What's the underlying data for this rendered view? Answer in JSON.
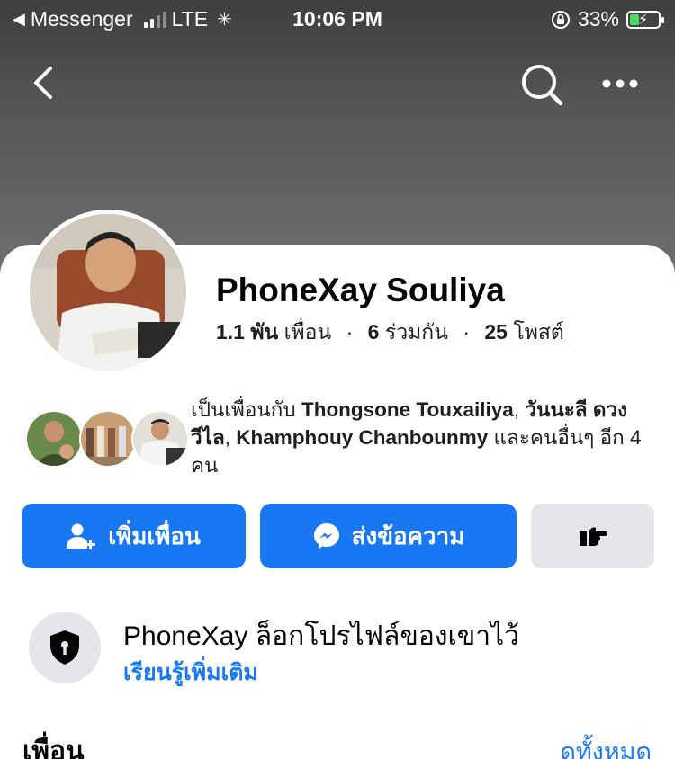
{
  "status_bar": {
    "back_app": "Messenger",
    "network": "LTE",
    "time": "10:06 PM",
    "battery": "33%"
  },
  "nav": {
    "back_icon": "chevron-left-icon",
    "search_icon": "search-icon",
    "more_icon": "more-horizontal-icon"
  },
  "profile": {
    "name": "PhoneXay Souliya",
    "friends_count": "1.1 พัน",
    "friends_label": "เพื่อน",
    "mutual_count": "6",
    "mutual_label": "ร่วมกัน",
    "posts_count": "25",
    "posts_label": "โพสต์"
  },
  "mutual": {
    "prefix": "เป็นเพื่อนกับ",
    "friend1": "Thongsone Touxailiya",
    "friend2": "วันนะลี ดวงวีไล",
    "friend3": "Khamphouy Chanbounmy",
    "suffix": "และคนอื่นๆ อีก 4 คน"
  },
  "actions": {
    "add_friend": "เพิ่มเพื่อน",
    "message": "ส่งข้อความ"
  },
  "locked": {
    "title": "PhoneXay ล็อกโปรไฟล์ของเขาไว้",
    "link": "เรียนรู้เพิ่มเติม"
  },
  "friends_section": {
    "title": "เพื่อน",
    "see_all": "ดูทั้งหมด"
  },
  "colors": {
    "accent": "#1877f2",
    "secondary_button": "#e4e6eb"
  }
}
